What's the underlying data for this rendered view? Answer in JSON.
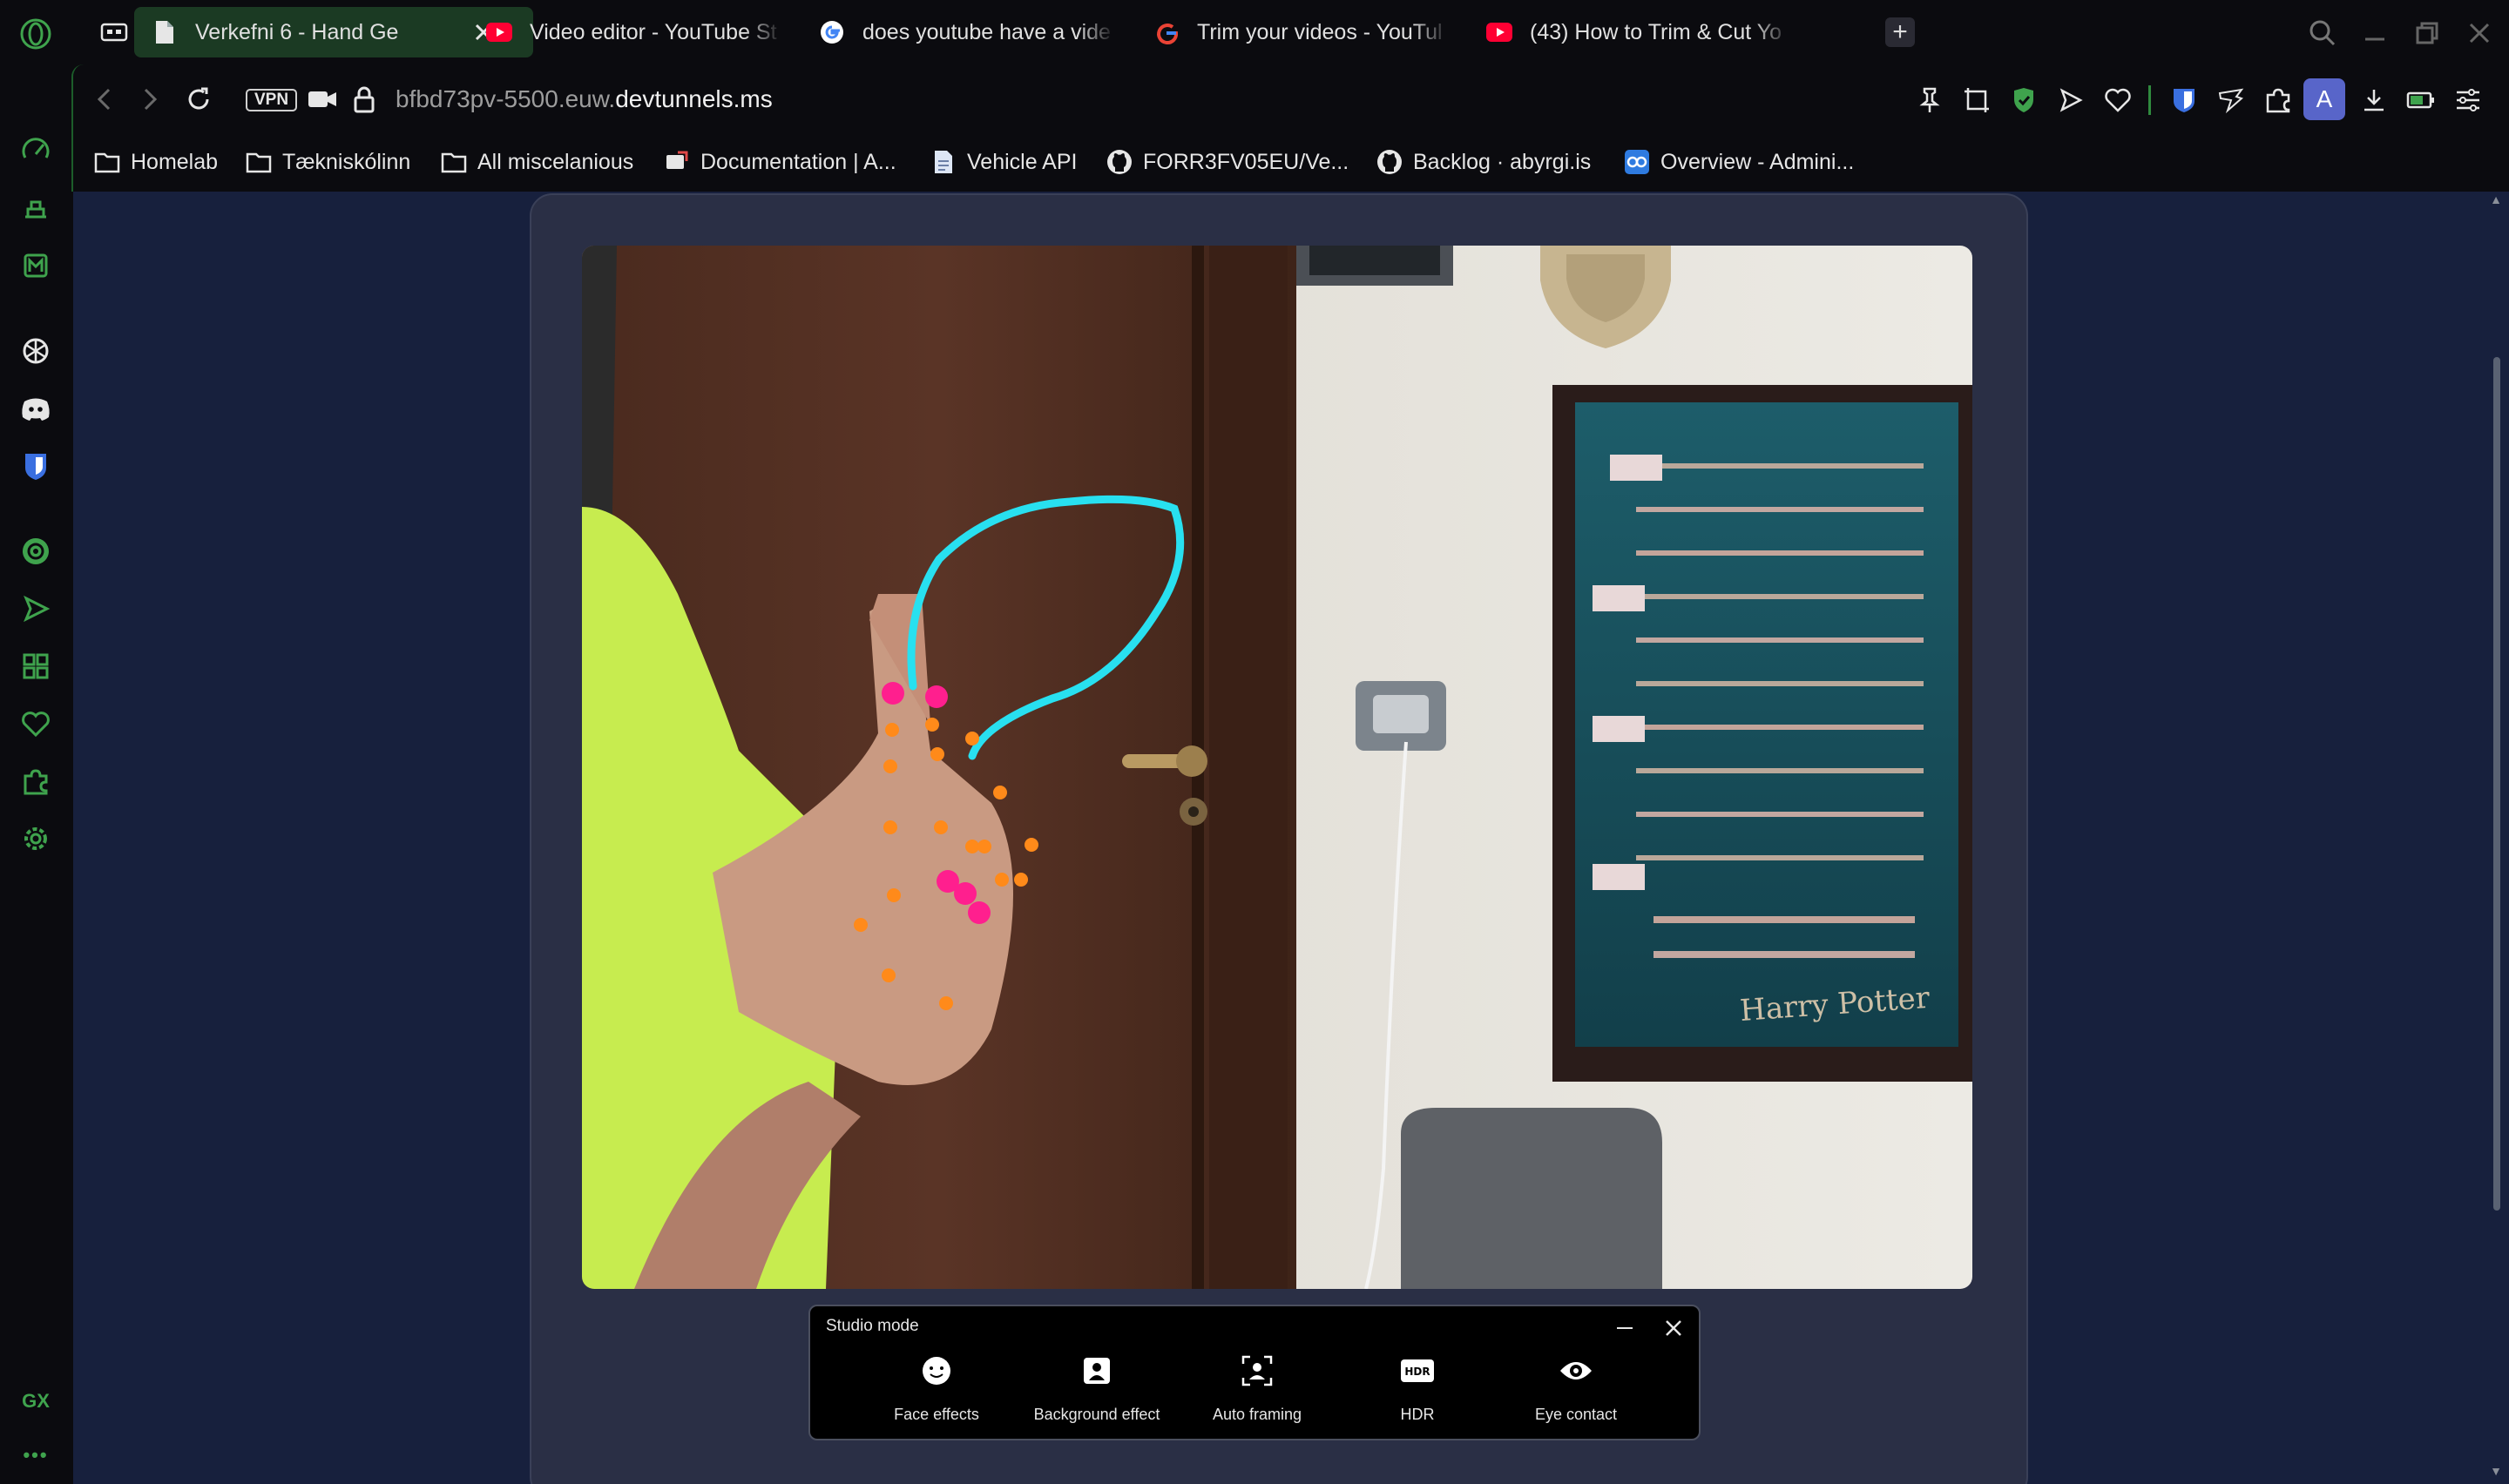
{
  "browser": {
    "tabs": [
      {
        "title": "Verkefni 6 - Hand Ge",
        "icon": "document-icon",
        "active": true
      },
      {
        "title": "Video editor - YouTube St",
        "icon": "youtube-icon",
        "active": false
      },
      {
        "title": "does youtube have a vide",
        "icon": "google-icon",
        "active": false
      },
      {
        "title": "Trim your videos - YouTul",
        "icon": "google-icon",
        "active": false
      },
      {
        "title": "(43) How to Trim & Cut Yo",
        "icon": "youtube-icon",
        "active": false
      }
    ],
    "new_tab_label": "+",
    "address": {
      "vpn_label": "VPN",
      "url_prefix": "bfbd73pv-5500.euw.",
      "url_domain": "devtunnels.ms"
    },
    "avatar_letter": "A",
    "sidebar_text": {
      "gx": "GX",
      "more": "•••"
    },
    "bookmarks": [
      {
        "label": "Homelab",
        "icon": "folder-icon"
      },
      {
        "label": "Tækniskólinn",
        "icon": "folder-icon"
      },
      {
        "label": "All miscelanious",
        "icon": "folder-icon"
      },
      {
        "label": "Documentation | A...",
        "icon": "docs-icon"
      },
      {
        "label": "Vehicle API",
        "icon": "page-icon"
      },
      {
        "label": "FORR3FV05EU/Ve...",
        "icon": "github-icon"
      },
      {
        "label": "Backlog · abyrgi.is",
        "icon": "github-icon"
      },
      {
        "label": "Overview - Admini...",
        "icon": "azure-icon"
      }
    ]
  },
  "webcam_overlay": {
    "poster_text": "Harry Potter"
  },
  "studio_mode": {
    "title": "Studio mode",
    "features": [
      {
        "label": "Face effects",
        "icon": "face-icon"
      },
      {
        "label": "Background effect",
        "icon": "background-icon"
      },
      {
        "label": "Auto framing",
        "icon": "framing-icon"
      },
      {
        "label": "HDR",
        "icon": "hdr-icon"
      },
      {
        "label": "Eye contact",
        "icon": "eye-icon"
      }
    ]
  },
  "colors": {
    "accent": "#3fa34d",
    "page_bg": "#17203d",
    "card_bg": "#2a2f45",
    "trail": "#28e0f0",
    "landmark_tip": "#ff1f8e",
    "landmark": "#ff8a1a"
  }
}
